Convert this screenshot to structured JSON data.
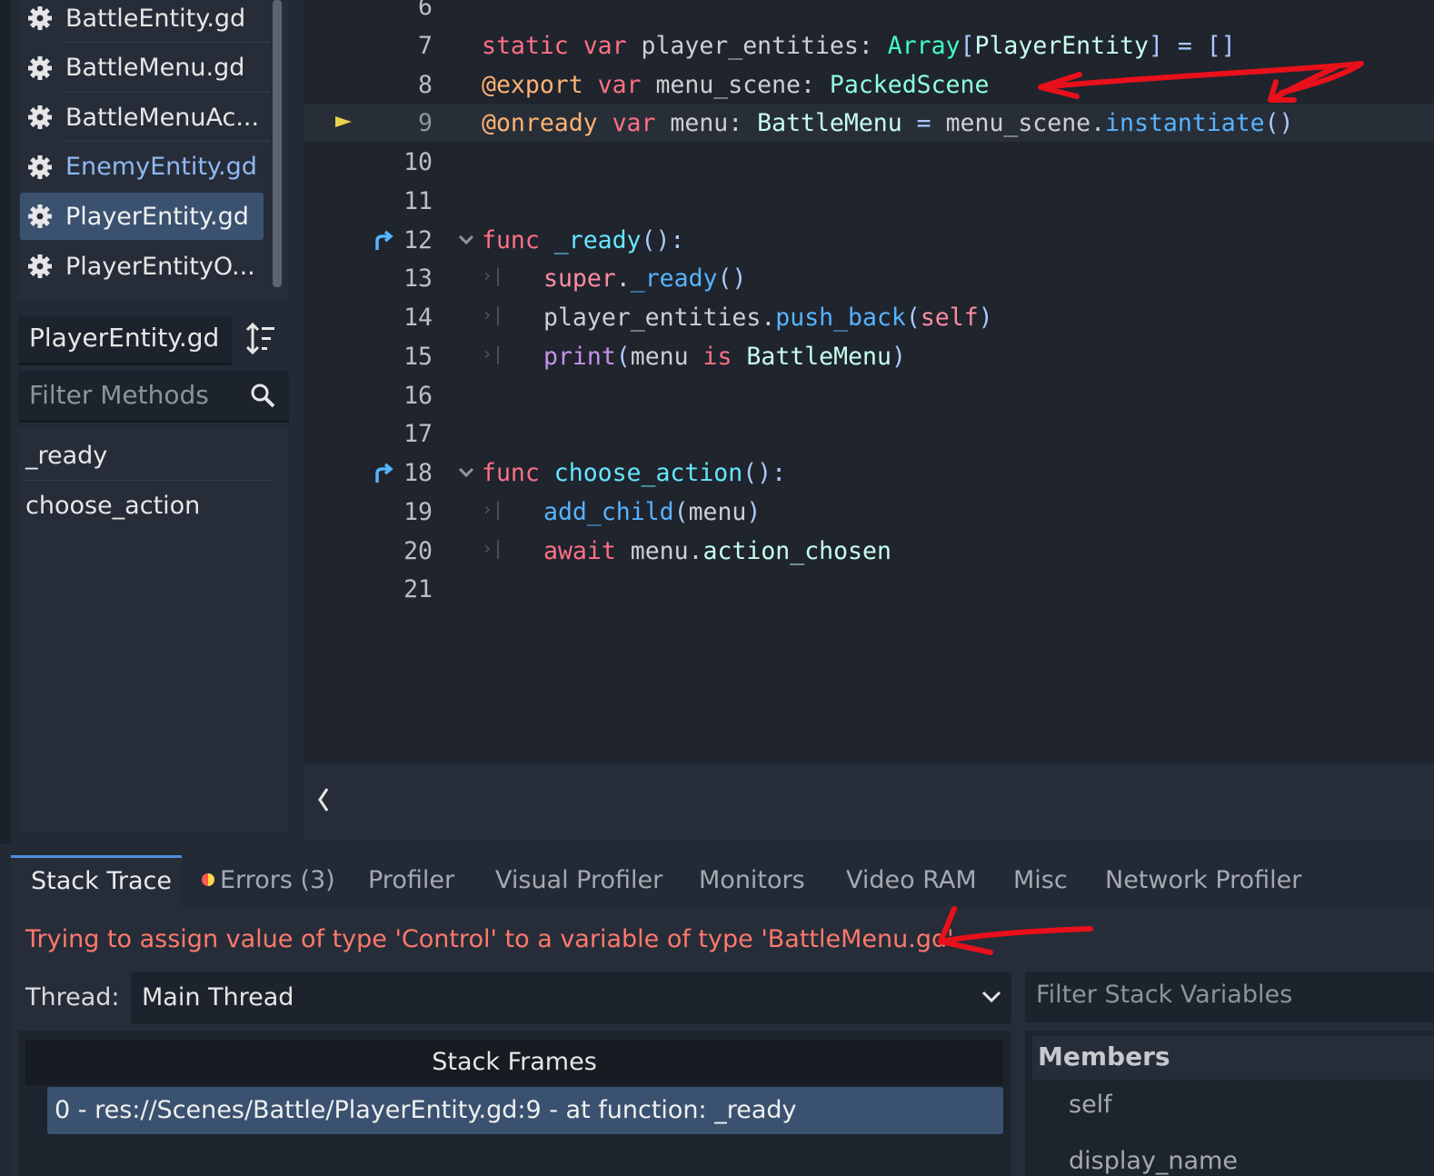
{
  "file_list": {
    "items": [
      {
        "name": "BattleEntity.gd",
        "color": "#e6e6e6"
      },
      {
        "name": "BattleMenu.gd",
        "color": "#e6e6e6"
      },
      {
        "name": "BattleMenuAc...",
        "color": "#e6e6e6"
      },
      {
        "name": "EnemyEntity.gd",
        "color": "#8fb8f0"
      },
      {
        "name": "PlayerEntity.gd",
        "color": "#f0f0f0"
      },
      {
        "name": "PlayerEntityO...",
        "color": "#e6e6e6"
      }
    ],
    "selected_index": 4,
    "item_icon": "gear-icon"
  },
  "outline": {
    "current_script": "PlayerEntity.gd",
    "sort_icon": "sort-icon",
    "filter_placeholder": "Filter Methods",
    "filter_icon": "search-icon",
    "methods": [
      "_ready",
      "choose_action"
    ]
  },
  "editor": {
    "current_line": 9,
    "lines": [
      {
        "n": "6"
      },
      {
        "n": "7",
        "code": [
          {
            "t": "static ",
            "c": "kw"
          },
          {
            "t": "var ",
            "c": "kw"
          },
          {
            "t": "player_entities: ",
            "c": "pln"
          },
          {
            "t": "Array",
            "c": "ty2"
          },
          {
            "t": "[",
            "c": "sym"
          },
          {
            "t": "PlayerEntity",
            "c": "cls"
          },
          {
            "t": "] = []",
            "c": "sym"
          }
        ]
      },
      {
        "n": "8",
        "code": [
          {
            "t": "@export ",
            "c": "ann"
          },
          {
            "t": "var ",
            "c": "kw"
          },
          {
            "t": "menu_scene: ",
            "c": "pln"
          },
          {
            "t": "PackedScene",
            "c": "typ"
          }
        ]
      },
      {
        "n": "9",
        "code": [
          {
            "t": "@onready ",
            "c": "ann"
          },
          {
            "t": "var ",
            "c": "kw"
          },
          {
            "t": "menu: ",
            "c": "pln"
          },
          {
            "t": "BattleMenu",
            "c": "cls"
          },
          {
            "t": " = ",
            "c": "sym"
          },
          {
            "t": "menu_scene.",
            "c": "pln"
          },
          {
            "t": "instantiate",
            "c": "mth"
          },
          {
            "t": "()",
            "c": "sym"
          }
        ]
      },
      {
        "n": "10"
      },
      {
        "n": "11"
      },
      {
        "n": "12",
        "fold": true,
        "override": true,
        "code": [
          {
            "t": "func ",
            "c": "kw"
          },
          {
            "t": "_ready",
            "c": "fn"
          },
          {
            "t": "():",
            "c": "sym"
          }
        ]
      },
      {
        "n": "13",
        "indent": true,
        "code": [
          {
            "t": "super",
            "c": "kw2"
          },
          {
            "t": ".",
            "c": "pln"
          },
          {
            "t": "_ready",
            "c": "mth"
          },
          {
            "t": "()",
            "c": "sym"
          }
        ]
      },
      {
        "n": "14",
        "indent": true,
        "code": [
          {
            "t": "player_entities.",
            "c": "pln"
          },
          {
            "t": "push_back",
            "c": "mth"
          },
          {
            "t": "(",
            "c": "sym"
          },
          {
            "t": "self",
            "c": "kw2"
          },
          {
            "t": ")",
            "c": "sym"
          }
        ]
      },
      {
        "n": "15",
        "indent": true,
        "code": [
          {
            "t": "print",
            "c": "prn"
          },
          {
            "t": "(",
            "c": "sym"
          },
          {
            "t": "menu ",
            "c": "pln"
          },
          {
            "t": "is ",
            "c": "kw"
          },
          {
            "t": "BattleMenu",
            "c": "cls"
          },
          {
            "t": ")",
            "c": "sym"
          }
        ]
      },
      {
        "n": "16"
      },
      {
        "n": "17"
      },
      {
        "n": "18",
        "fold": true,
        "override": true,
        "code": [
          {
            "t": "func ",
            "c": "kw"
          },
          {
            "t": "choose_action",
            "c": "fn"
          },
          {
            "t": "():",
            "c": "sym"
          }
        ]
      },
      {
        "n": "19",
        "indent": true,
        "code": [
          {
            "t": "add_child",
            "c": "mth"
          },
          {
            "t": "(",
            "c": "sym"
          },
          {
            "t": "menu",
            "c": "pln"
          },
          {
            "t": ")",
            "c": "sym"
          }
        ]
      },
      {
        "n": "20",
        "indent": true,
        "code": [
          {
            "t": "await ",
            "c": "kw"
          },
          {
            "t": "menu.",
            "c": "pln"
          },
          {
            "t": "action_chosen",
            "c": "cls"
          }
        ]
      },
      {
        "n": "21"
      }
    ]
  },
  "debugger": {
    "tabs": [
      "Stack Trace",
      "Errors (3)",
      "Profiler",
      "Visual Profiler",
      "Monitors",
      "Video RAM",
      "Misc",
      "Network Profiler"
    ],
    "active_tab": "Stack Trace",
    "error_message": "Trying to assign value of type 'Control' to a variable of type 'BattleMenu.gd'.",
    "thread_label": "Thread:",
    "thread_value": "Main Thread",
    "stack_frames_header": "Stack Frames",
    "stack_frames": [
      "0 - res://Scenes/Battle/PlayerEntity.gd:9 - at function: _ready"
    ],
    "variables_filter_placeholder": "Filter Stack Variables",
    "members_header": "Members",
    "members": [
      "self",
      "display_name"
    ]
  },
  "colors": {
    "accent": "#4f8fd6",
    "error_text": "#ff786b",
    "annotation_arrow": "#e8101a",
    "breakpoint_marker": "#e8d34a"
  }
}
